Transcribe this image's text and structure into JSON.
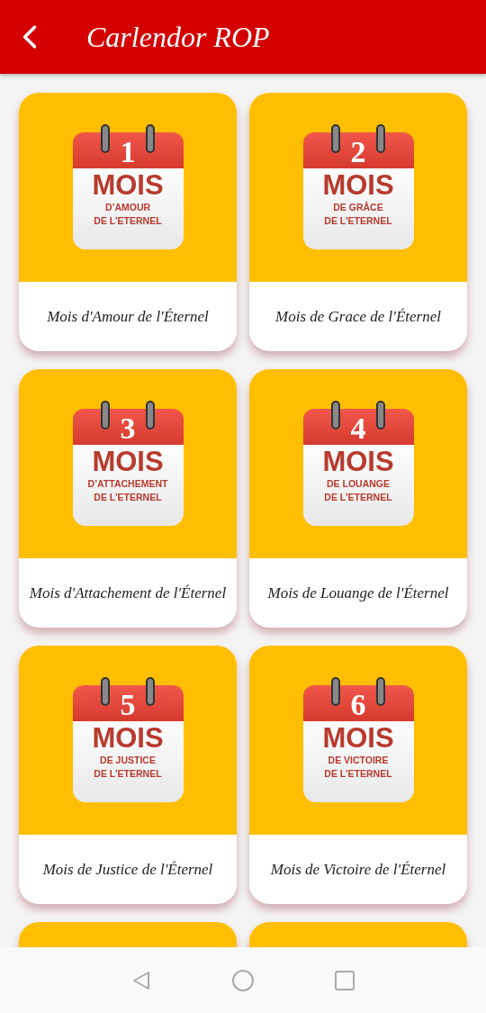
{
  "app_bar": {
    "title": "Carlendor ROP"
  },
  "cards": [
    {
      "kind": "full",
      "number": "1",
      "heading": "MOIS",
      "subtitle": [
        "D’AMOUR",
        "DE L’ETERNEL"
      ],
      "label": "Mois d'Amour de l'Éternel"
    },
    {
      "kind": "full",
      "number": "2",
      "heading": "MOIS",
      "subtitle": [
        "DE GRÂCE",
        "DE L’ETERNEL"
      ],
      "label": "Mois de Grace de l'Éternel"
    },
    {
      "kind": "full",
      "number": "3",
      "heading": "MOIS",
      "subtitle": [
        "D’ATTACHEMENT",
        "DE L’ETERNEL"
      ],
      "label": "Mois d'Attachement de l'Éternel"
    },
    {
      "kind": "full",
      "number": "4",
      "heading": "MOIS",
      "subtitle": [
        "DE LOUANGE",
        "DE L’ETERNEL"
      ],
      "label": "Mois de Louange de l'Éternel"
    },
    {
      "kind": "full",
      "number": "5",
      "heading": "MOIS",
      "subtitle": [
        "DE JUSTICE",
        "DE L’ETERNEL"
      ],
      "label": "Mois de Justice de l'Éternel"
    },
    {
      "kind": "full",
      "number": "6",
      "heading": "MOIS",
      "subtitle": [
        "DE VICTOIRE",
        "DE L’ETERNEL"
      ],
      "label": "Mois de Victoire de l'Éternel"
    },
    {
      "kind": "clipped"
    },
    {
      "kind": "clipped"
    }
  ]
}
